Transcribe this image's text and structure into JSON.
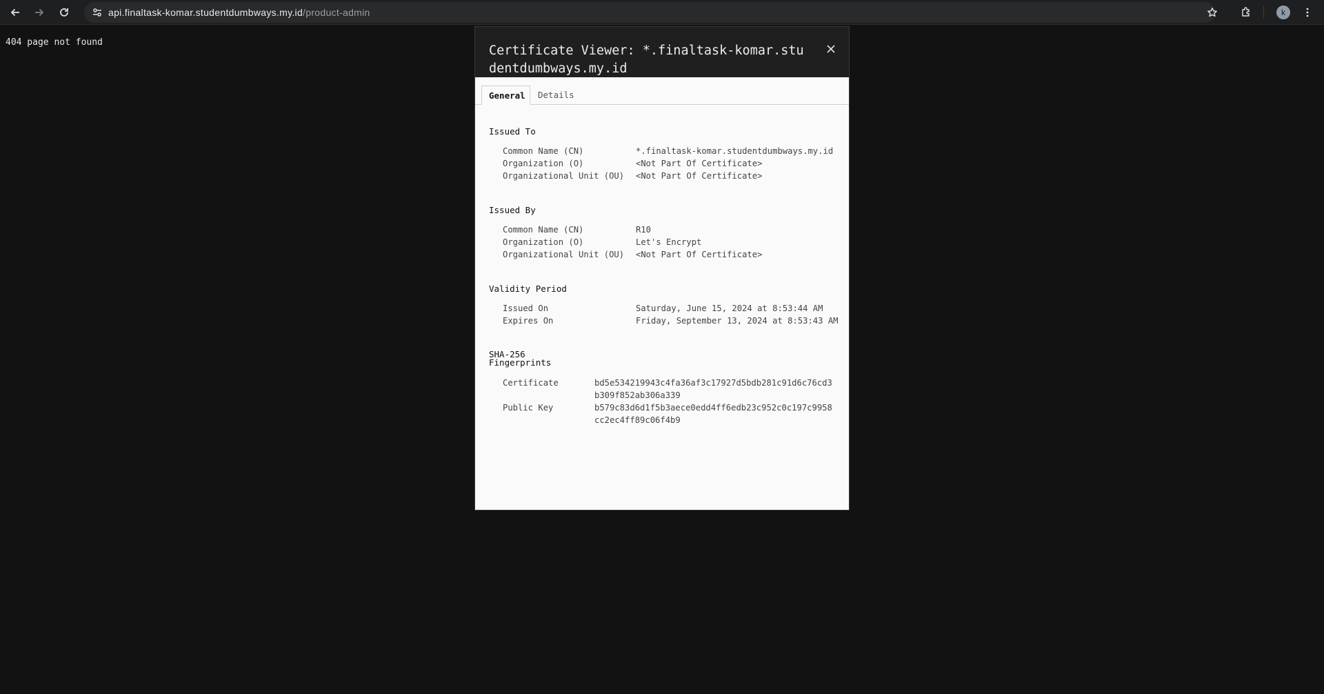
{
  "browser": {
    "url_host": "api.finaltask-komar.studentdumbways.my.id",
    "url_path": "/product-admin",
    "profile_initial": "k",
    "icons": [
      "back-arrow-icon",
      "forward-arrow-icon",
      "reload-icon",
      "site-info-icon",
      "bookmark-star-icon",
      "extensions-icon",
      "kebab-menu-icon"
    ]
  },
  "page": {
    "message": "404 page not found"
  },
  "dialog": {
    "title": "Certificate Viewer: *.finaltask-komar.studentdumbways.my.id",
    "tabs": [
      "General",
      "Details"
    ],
    "issued_to": {
      "title": "Issued To",
      "rows": [
        {
          "label": "Common Name (CN)",
          "value": "*.finaltask-komar.studentdumbways.my.id"
        },
        {
          "label": "Organization (O)",
          "value": "<Not Part Of Certificate>"
        },
        {
          "label": "Organizational Unit (OU)",
          "value": "<Not Part Of Certificate>"
        }
      ]
    },
    "issued_by": {
      "title": "Issued By",
      "rows": [
        {
          "label": "Common Name (CN)",
          "value": "R10"
        },
        {
          "label": "Organization (O)",
          "value": "Let's Encrypt"
        },
        {
          "label": "Organizational Unit (OU)",
          "value": "<Not Part Of Certificate>"
        }
      ]
    },
    "validity": {
      "title": "Validity Period",
      "rows": [
        {
          "label": "Issued On",
          "value": "Saturday, June 15, 2024 at 8:53:44 AM"
        },
        {
          "label": "Expires On",
          "value": "Friday, September 13, 2024 at 8:53:43 AM"
        }
      ]
    },
    "fingerprints": {
      "title_line1": "SHA-256",
      "title_line2": "Fingerprints",
      "rows": [
        {
          "label": "Certificate",
          "value": "bd5e534219943c4fa36af3c17927d5bdb281c91d6c76cd3b309f852ab306a339"
        },
        {
          "label": "Public Key",
          "value": "b579c83d6d1f5b3aece0edd4ff6edb23c952c0c197c9958cc2ec4ff89c06f4b9"
        }
      ]
    }
  }
}
